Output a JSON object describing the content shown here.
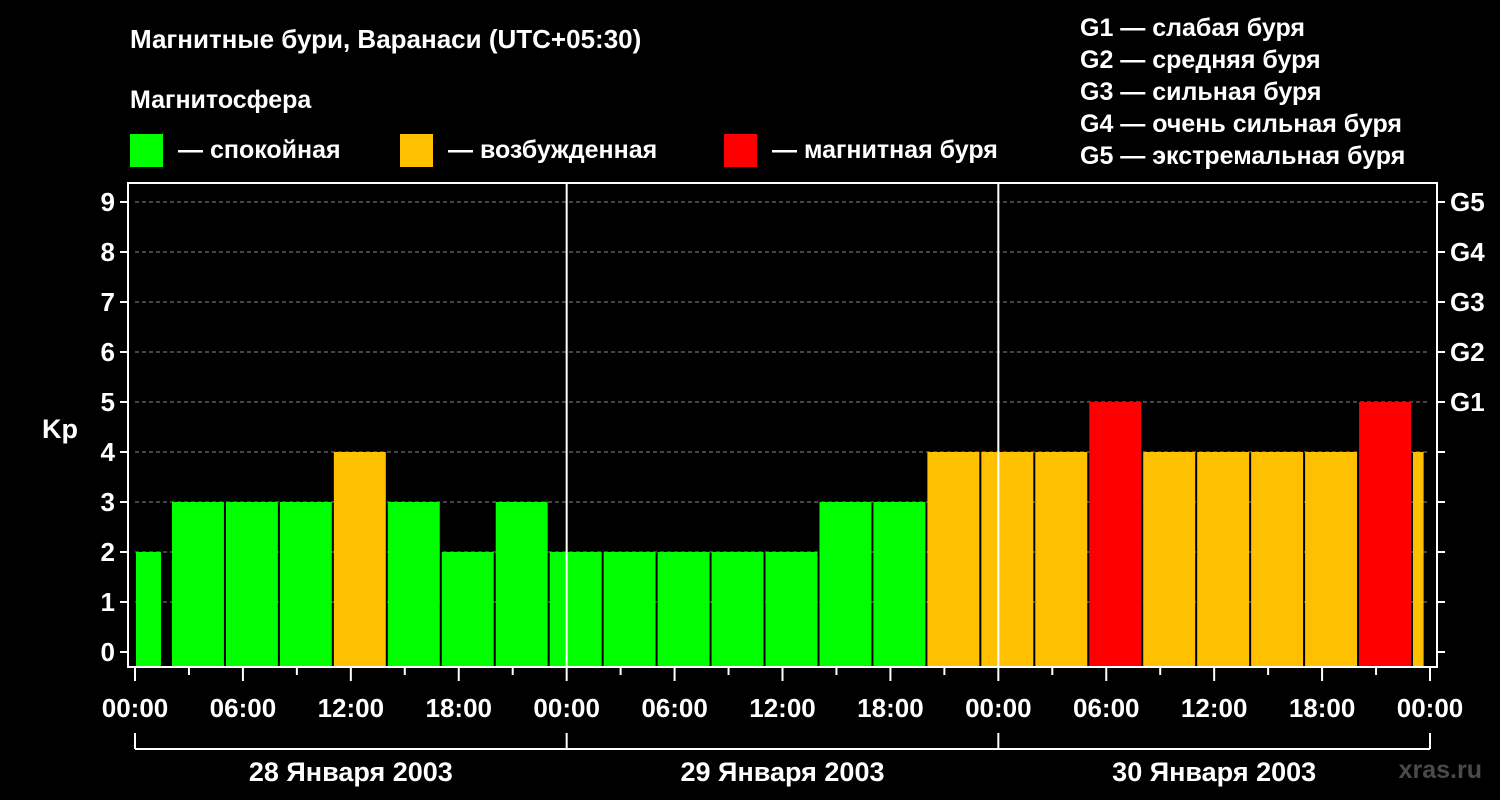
{
  "title": "Магнитные бури, Варанаси (UTC+05:30)",
  "subtitle": "Магнитосфера",
  "legend": [
    {
      "label": "— спокойная",
      "color": "#00ff00"
    },
    {
      "label": "— возбужденная",
      "color": "#ffc000"
    },
    {
      "label": "— магнитная буря",
      "color": "#ff0000"
    }
  ],
  "g_scale": [
    "G1 — слабая буря",
    "G2 — средняя буря",
    "G3 — сильная буря",
    "G4 — очень сильная буря",
    "G5 — экстремальная буря"
  ],
  "watermark": "xras.ru",
  "chart_data": {
    "type": "bar",
    "ylabel": "Kp",
    "ylim": [
      0,
      9
    ],
    "y_ticks": [
      0,
      1,
      2,
      3,
      4,
      5,
      6,
      7,
      8,
      9
    ],
    "right_ticks": [
      {
        "value": 5,
        "label": "G1"
      },
      {
        "value": 6,
        "label": "G2"
      },
      {
        "value": 7,
        "label": "G3"
      },
      {
        "value": 8,
        "label": "G4"
      },
      {
        "value": 9,
        "label": "G5"
      }
    ],
    "grid": true,
    "x_hours_start": 0,
    "x_hours_end": 72,
    "time_tick_labels": [
      "00:00",
      "06:00",
      "12:00",
      "18:00",
      "00:00",
      "06:00",
      "12:00",
      "18:00",
      "00:00",
      "06:00",
      "12:00",
      "18:00",
      "00:00"
    ],
    "day_labels": [
      "28 Января 2003",
      "29 Января 2003",
      "30 Января 2003"
    ],
    "day_boundaries_hours": [
      24,
      48
    ],
    "colors": {
      "quiet": "#00ff00",
      "active": "#ffc000",
      "storm": "#ff0000"
    },
    "bars": [
      {
        "start": 0,
        "end": 1.5,
        "kp": 2
      },
      {
        "start": 2,
        "end": 5,
        "kp": 3
      },
      {
        "start": 5,
        "end": 8,
        "kp": 3
      },
      {
        "start": 8,
        "end": 11,
        "kp": 3
      },
      {
        "start": 11,
        "end": 14,
        "kp": 4
      },
      {
        "start": 14,
        "end": 17,
        "kp": 3
      },
      {
        "start": 17,
        "end": 20,
        "kp": 2
      },
      {
        "start": 20,
        "end": 23,
        "kp": 3
      },
      {
        "start": 23,
        "end": 26,
        "kp": 2
      },
      {
        "start": 26,
        "end": 29,
        "kp": 2
      },
      {
        "start": 29,
        "end": 32,
        "kp": 2
      },
      {
        "start": 32,
        "end": 35,
        "kp": 2
      },
      {
        "start": 35,
        "end": 38,
        "kp": 2
      },
      {
        "start": 38,
        "end": 41,
        "kp": 3
      },
      {
        "start": 41,
        "end": 44,
        "kp": 3
      },
      {
        "start": 44,
        "end": 47,
        "kp": 4
      },
      {
        "start": 47,
        "end": 50,
        "kp": 4
      },
      {
        "start": 50,
        "end": 53,
        "kp": 4
      },
      {
        "start": 53,
        "end": 56,
        "kp": 5
      },
      {
        "start": 56,
        "end": 59,
        "kp": 4
      },
      {
        "start": 59,
        "end": 62,
        "kp": 4
      },
      {
        "start": 62,
        "end": 65,
        "kp": 4
      },
      {
        "start": 65,
        "end": 68,
        "kp": 4
      },
      {
        "start": 68,
        "end": 71,
        "kp": 5
      },
      {
        "start": 71,
        "end": 71.7,
        "kp": 4
      }
    ]
  }
}
